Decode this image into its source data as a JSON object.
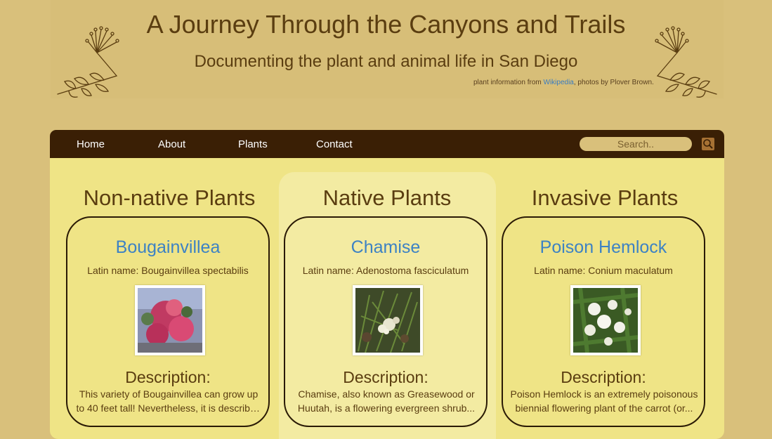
{
  "header": {
    "title": "A Journey Through the Canyons and Trails",
    "subtitle": "Documenting the plant and animal life in San Diego",
    "credit_prefix": "plant information from ",
    "credit_link": "Wikipedia",
    "credit_suffix": ", photos by Plover Brown."
  },
  "nav": {
    "items": [
      {
        "label": "Home"
      },
      {
        "label": "About"
      },
      {
        "label": "Plants"
      },
      {
        "label": "Contact"
      }
    ],
    "search_placeholder": "Search.."
  },
  "columns": [
    {
      "heading": "Non-native Plants",
      "card": {
        "name": "Bougainvillea",
        "latin": "Latin name: Bougainvillea spectabilis",
        "description_heading": "Description:",
        "description": "This variety of Bougainvillea can grow up to 40 feet tall! Nevertheless, it is described a..."
      }
    },
    {
      "heading": "Native Plants",
      "card": {
        "name": "Chamise",
        "latin": "Latin name: Adenostoma fasciculatum",
        "description_heading": "Description:",
        "description": "Chamise, also known as Greasewood or Huutah, is a flowering evergreen shrub..."
      }
    },
    {
      "heading": "Invasive Plants",
      "card": {
        "name": "Poison Hemlock",
        "latin": "Latin name: Conium maculatum",
        "description_heading": "Description:",
        "description": "Poison Hemlock is an extremely poisonous biennial flowering plant of the carrot (or..."
      }
    }
  ],
  "colors": {
    "page_bg": "#d9c07b",
    "nav_bg": "#3a1f05",
    "panel_bg": "#efe486",
    "highlight_bg": "#f3eba2",
    "heading_text": "#5a3d10",
    "link": "#3d82c4"
  }
}
